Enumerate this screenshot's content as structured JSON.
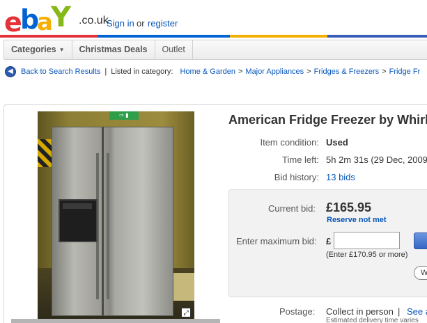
{
  "header": {
    "logo_text": "ebay",
    "domain": ".co.uk",
    "sign_in": "Sign in",
    "or": "or",
    "register": "register",
    "brand_colors": [
      "#e53238",
      "#0064d2",
      "#f5af02",
      "#86b817"
    ]
  },
  "nav": {
    "items": [
      {
        "label": "Categories",
        "has_dropdown": true
      },
      {
        "label": "Christmas Deals"
      },
      {
        "label": "Outlet"
      }
    ]
  },
  "breadcrumb": {
    "back_label": "Back to Search Results",
    "listed_in": "Listed in category:",
    "path": [
      "Home & Garden",
      "Major Appliances",
      "Fridges & Freezers",
      "Fridge Fr"
    ]
  },
  "listing": {
    "title": "American Fridge Freezer by Whirl",
    "photo_alt": "stainless steel american fridge freezer",
    "details": [
      {
        "label": "Item condition:",
        "value": "Used",
        "style": "bold"
      },
      {
        "label": "Time left:",
        "value": "5h 2m 31s (29 Dec, 2009",
        "style": "normal"
      },
      {
        "label": "Bid history:",
        "value": "13 bids",
        "style": "link"
      }
    ],
    "bid": {
      "current_label": "Current bid:",
      "current_value": "£165.95",
      "reserve_status": "Reserve not met",
      "max_label": "Enter maximum bid:",
      "currency": "£",
      "input_value": "",
      "hint": "(Enter £170.95 or more)",
      "watch_label": "W"
    },
    "postage": {
      "label": "Postage:",
      "value": "Collect in person",
      "separator": "|",
      "link": "See al",
      "note": "Estimated delivery time varies"
    }
  }
}
